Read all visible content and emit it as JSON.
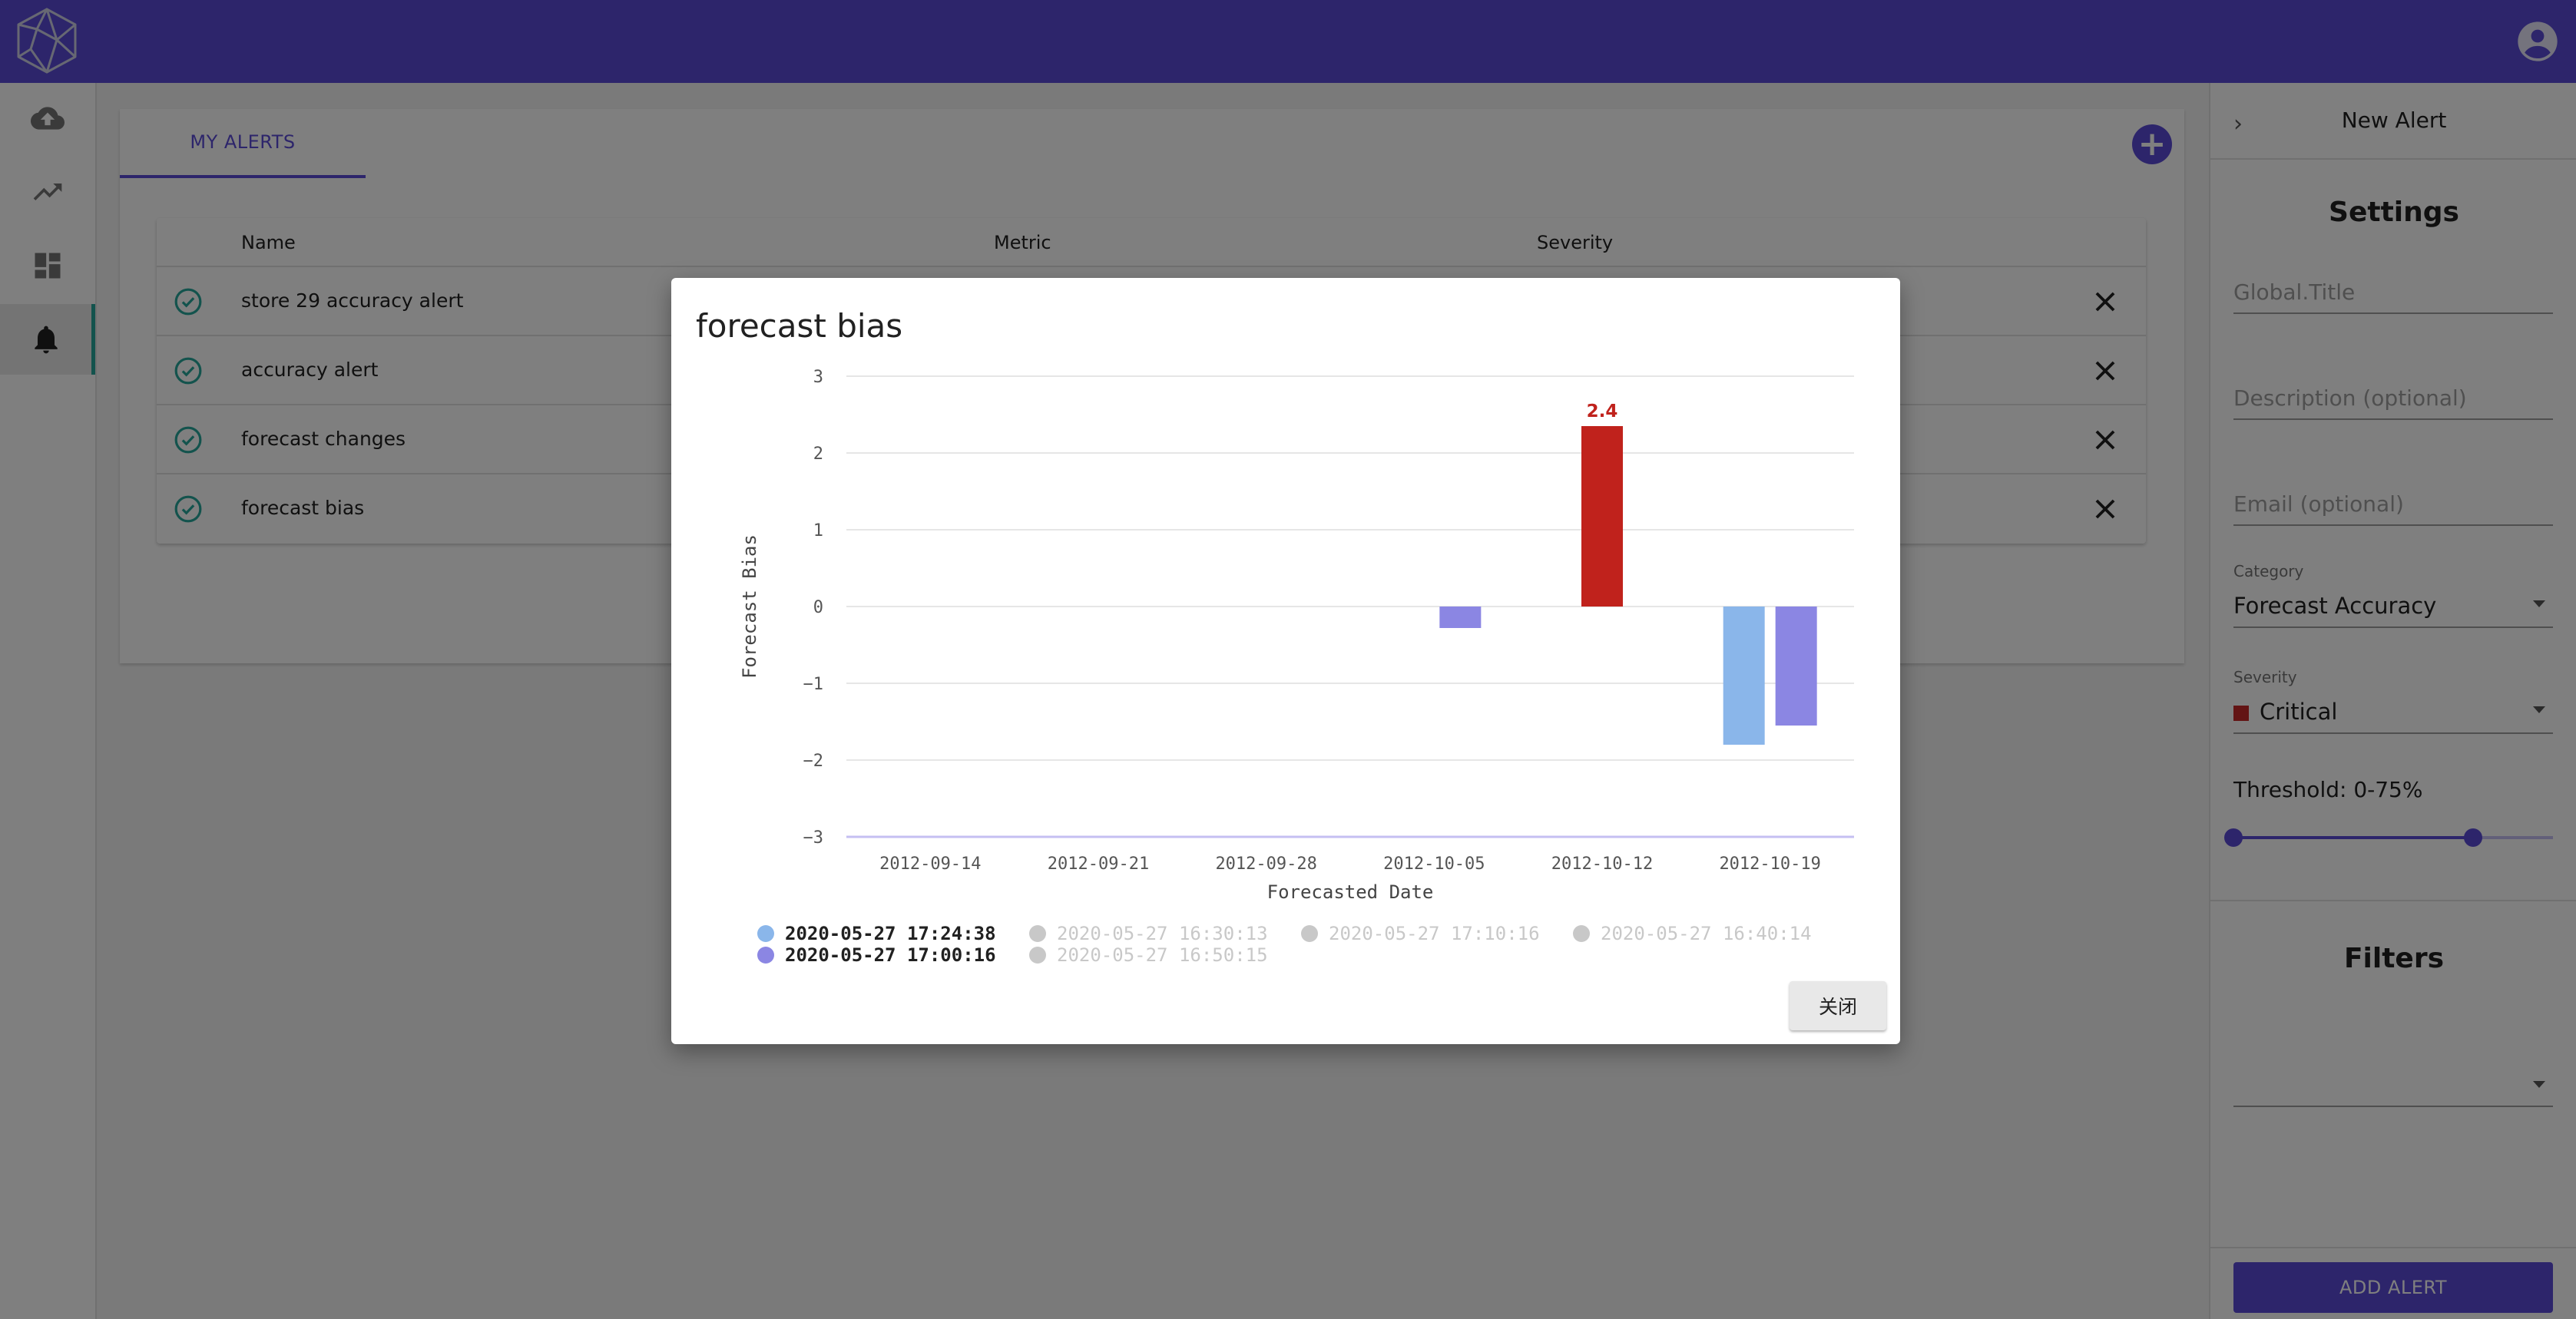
{
  "header": {
    "logo_icon": "polyhedron-logo-icon",
    "account_icon": "account-circle-icon",
    "color": "#5b4bd6"
  },
  "rail": {
    "items": [
      {
        "icon": "cloud-upload-icon"
      },
      {
        "icon": "trending-up-icon"
      },
      {
        "icon": "dashboard-icon"
      },
      {
        "icon": "bell-icon",
        "active": true
      }
    ]
  },
  "main": {
    "tab_label": "MY ALERTS",
    "add_icon": "plus-icon",
    "table": {
      "columns": [
        "Name",
        "Metric",
        "Severity"
      ],
      "rows": [
        {
          "name": "store 29 accuracy alert"
        },
        {
          "name": "accuracy alert"
        },
        {
          "name": "forecast changes"
        },
        {
          "name": "forecast bias"
        }
      ]
    }
  },
  "panel": {
    "title": "New Alert",
    "settings_title": "Settings",
    "title_placeholder": "Global.Title",
    "description_placeholder": "Description (optional)",
    "email_placeholder": "Email (optional)",
    "category_label": "Category",
    "category_value": "Forecast Accuracy",
    "severity_label": "Severity",
    "severity_value": "Critical",
    "severity_color": "#c62828",
    "threshold_label": "Threshold: 0-75%",
    "threshold_range": [
      0,
      75
    ],
    "filters_title": "Filters",
    "add_button": "ADD ALERT"
  },
  "dialog": {
    "title": "forecast bias",
    "close_label": "关闭"
  },
  "chart_data": {
    "type": "bar",
    "xlabel": "Forecasted Date",
    "ylabel": "Forecast Bias",
    "categories": [
      "2012-09-14",
      "2012-09-21",
      "2012-09-28",
      "2012-10-05",
      "2012-10-12",
      "2012-10-19"
    ],
    "ylim": [
      -3,
      3
    ],
    "yticks": [
      "3",
      "2",
      "1",
      "0",
      "−1",
      "−2",
      "−3"
    ],
    "grid": true,
    "series": [
      {
        "name": "2020-05-27 17:24:38",
        "color": "#8ab6ea",
        "visible": true,
        "values": [
          null,
          null,
          null,
          null,
          null,
          -1.8
        ]
      },
      {
        "name": "2020-05-27 17:00:16",
        "color": "#8b86e3",
        "visible": true,
        "values": [
          null,
          null,
          null,
          -0.28,
          null,
          -1.55
        ]
      },
      {
        "name": "2020-05-27 16:30:13",
        "color": "#c8c8c8",
        "visible": false,
        "values": []
      },
      {
        "name": "2020-05-27 16:50:15",
        "color": "#c8c8c8",
        "visible": false,
        "values": []
      },
      {
        "name": "2020-05-27 17:10:16",
        "color": "#c8c8c8",
        "visible": false,
        "values": []
      },
      {
        "name": "2020-05-27 16:40:14",
        "color": "#c8c8c8",
        "visible": false,
        "values": []
      }
    ],
    "highlight": {
      "category": "2012-10-12",
      "value": 2.35,
      "label": "2.4",
      "color": "#c0221c"
    },
    "legend_position": "bottom"
  }
}
